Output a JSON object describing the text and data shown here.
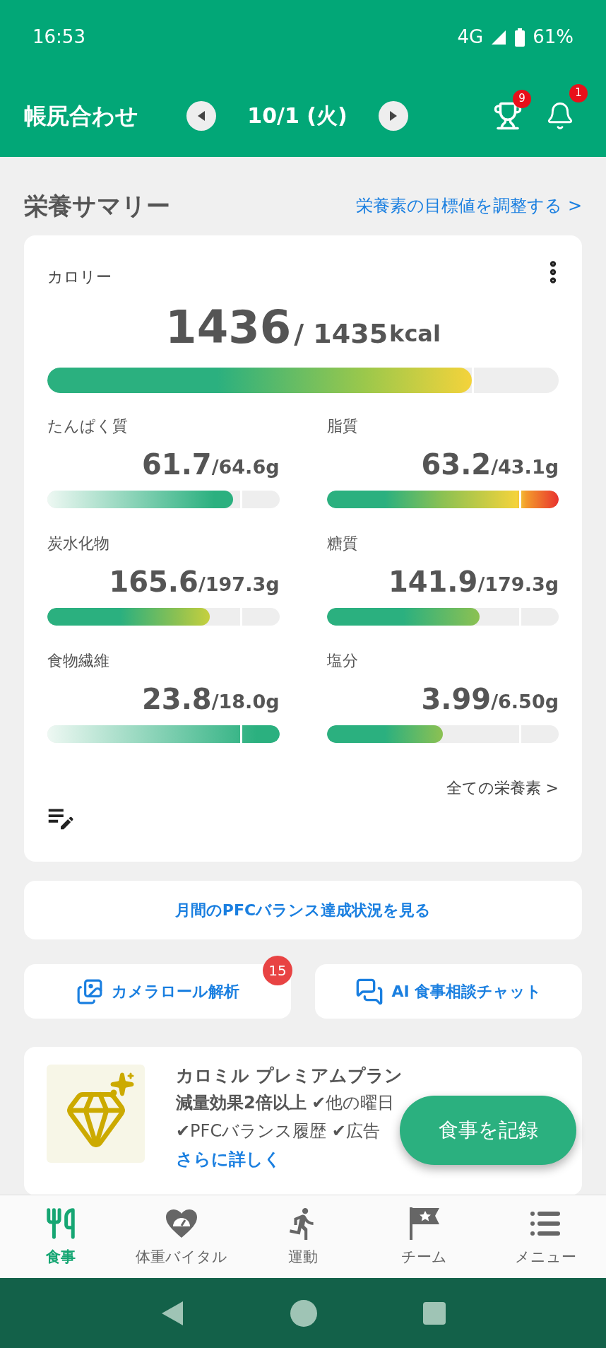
{
  "status_bar": {
    "time": "16:53",
    "network": "4G",
    "battery": "61%"
  },
  "header": {
    "title": "帳尻合わせ",
    "date": "10/1 (火)",
    "trophy_badge": "9",
    "bell_badge": "1"
  },
  "summary": {
    "title": "栄養サマリー",
    "adjust_link": "栄養素の目標値を調整する >"
  },
  "calorie": {
    "label": "カロリー",
    "value": "1436",
    "target": "/ 1435",
    "unit": "kcal",
    "level": 0.83
  },
  "nutrients": [
    {
      "name": "たんぱく質",
      "value": "61.7",
      "target": "/64.6g",
      "level": 0.8,
      "kind": "fade"
    },
    {
      "name": "脂質",
      "value": "63.2",
      "target": "/43.1g",
      "level": 1,
      "kind": "over"
    },
    {
      "name": "炭水化物",
      "value": "165.6",
      "target": "/197.3g",
      "level": 0.7,
      "kind": "warm"
    },
    {
      "name": "糖質",
      "value": "141.9",
      "target": "/179.3g",
      "level": 0.66,
      "kind": "mild"
    },
    {
      "name": "食物繊維",
      "value": "23.8",
      "target": "/18.0g",
      "level": 1,
      "kind": "fade"
    },
    {
      "name": "塩分",
      "value": "3.99",
      "target": "/6.50g",
      "level": 0.5,
      "kind": "mild"
    }
  ],
  "all_nutrients_link": "全ての栄養素 >",
  "pfc_button": "月間のPFCバランス達成状況を見る",
  "actions": [
    {
      "label": "カメラロール解析",
      "badge": "15"
    },
    {
      "label": "AI 食事相談チャット"
    }
  ],
  "premium": {
    "title": "カロミル プレミアムプラン",
    "line_1": "**減量効果2倍以上** ✔他の曜日",
    "line_2": "✔PFCバランス履歴 ✔広告",
    "more_link": "さらに詳しく"
  },
  "fab": "食事を記録",
  "bottom_nav": [
    {
      "label": "食事",
      "selected": true
    },
    {
      "label": "体重バイタル",
      "selected": false
    },
    {
      "label": "運動",
      "selected": false
    },
    {
      "label": "チーム",
      "selected": false
    },
    {
      "label": "メニュー",
      "selected": false
    }
  ]
}
